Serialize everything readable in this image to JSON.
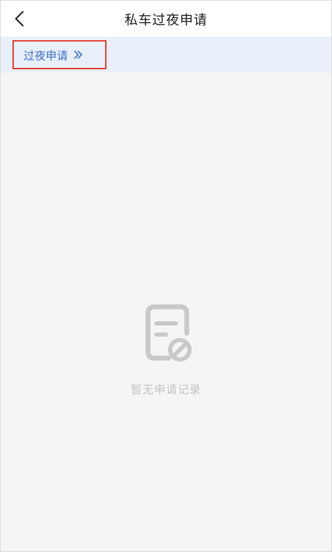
{
  "header": {
    "title": "私车过夜申请",
    "back_icon": "chevron-left-icon"
  },
  "subbar": {
    "link_label": "过夜申请",
    "link_icon": "double-chevron-right-icon",
    "link_color": "#3d6fc4",
    "highlight_color": "#e23b2e"
  },
  "empty_state": {
    "icon": "document-forbidden-icon",
    "text": "暂无申请记录"
  }
}
